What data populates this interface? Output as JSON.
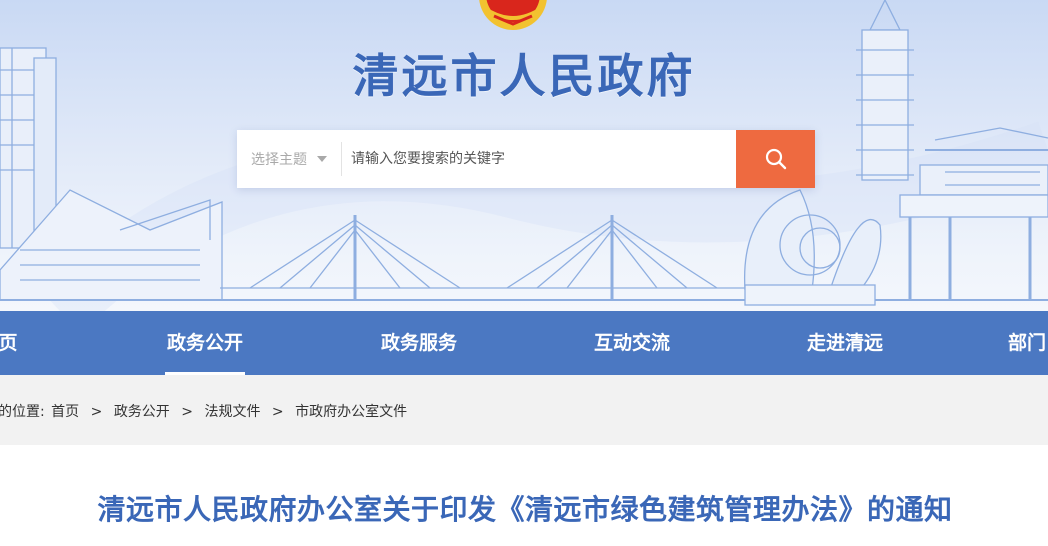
{
  "site": {
    "title": "清远市人民政府"
  },
  "search": {
    "topic_label": "选择主题",
    "placeholder": "请输入您要搜索的关键字"
  },
  "nav": {
    "items": [
      {
        "label": "页",
        "active": false
      },
      {
        "label": "政务公开",
        "active": true
      },
      {
        "label": "政务服务",
        "active": false
      },
      {
        "label": "互动交流",
        "active": false
      },
      {
        "label": "走进清远",
        "active": false
      },
      {
        "label": "部门",
        "active": false
      }
    ]
  },
  "breadcrumb": {
    "prefix": "的位置:",
    "items": [
      "首页",
      "政务公开",
      "法规文件",
      "市政府办公室文件"
    ],
    "separator": ">"
  },
  "article": {
    "title": "清远市人民政府办公室关于印发《清远市绿色建筑管理办法》的通知"
  },
  "colors": {
    "primary": "#4b78c2",
    "title_blue": "#3a67b7",
    "search_button": "#ee6a40",
    "emblem_red": "#d9261c",
    "emblem_gold": "#f2c230"
  },
  "icons": {
    "search": "search-icon",
    "dropdown": "caret-down-icon",
    "emblem": "national-emblem-icon"
  }
}
